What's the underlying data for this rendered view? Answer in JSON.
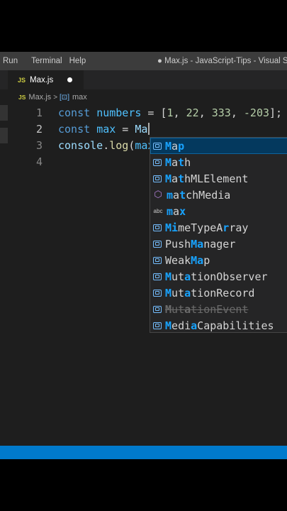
{
  "menu": [
    "Run",
    "Terminal",
    "Help"
  ],
  "window_title": "● Max.js - JavaScript-Tips - Visual Studio C",
  "tab": {
    "icon": "js-icon",
    "icon_text": "JS",
    "label": "Max.js",
    "dirty": true
  },
  "breadcrumb": {
    "file_icon_text": "JS",
    "file": "Max.js",
    "separator": ">",
    "symbol_icon": "variable-icon",
    "symbol": "max"
  },
  "editor": {
    "line_numbers": [
      "1",
      "2",
      "3",
      "4"
    ],
    "lines": [
      "const numbers = [1, 22, 333, -203];",
      "const max = Ma",
      "console.log(max);",
      ""
    ]
  },
  "suggestions": [
    {
      "icon": "variable-icon",
      "label": "Map",
      "match": [
        0,
        2
      ],
      "selected": true
    },
    {
      "icon": "variable-icon",
      "label": "Math",
      "match": [
        0,
        2
      ]
    },
    {
      "icon": "variable-icon",
      "label": "MathMLElement",
      "match": [
        0,
        2
      ]
    },
    {
      "icon": "method-icon",
      "label": "matchMedia",
      "match": [
        0,
        2
      ]
    },
    {
      "icon": "text-icon",
      "label": "max",
      "match": [
        0,
        2
      ]
    },
    {
      "icon": "variable-icon",
      "label": "MimeTypeArray",
      "match": [
        0,
        1,
        9
      ]
    },
    {
      "icon": "variable-icon",
      "label": "PushManager",
      "match": [
        4,
        5
      ]
    },
    {
      "icon": "variable-icon",
      "label": "WeakMap",
      "match": [
        4,
        5
      ]
    },
    {
      "icon": "variable-icon",
      "label": "MutationObserver",
      "match": [
        0,
        3
      ]
    },
    {
      "icon": "variable-icon",
      "label": "MutationRecord",
      "match": [
        0,
        3
      ]
    },
    {
      "icon": "variable-icon",
      "label": "MutationEvent",
      "match": [
        0,
        3
      ],
      "deprecated": true
    },
    {
      "icon": "variable-icon",
      "label": "MediaCapabilities",
      "match": [
        0,
        4
      ]
    }
  ],
  "colors": {
    "statusbar": "#007acc",
    "selection": "#04395e",
    "match_highlight": "#18a3ff"
  }
}
